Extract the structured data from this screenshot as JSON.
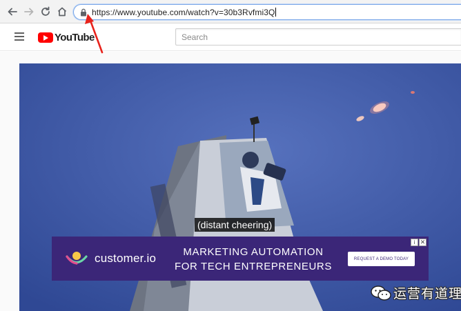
{
  "browser": {
    "url": "https://www.youtube.com/watch?v=30b3Rvfmi3Q",
    "back_icon": "arrow-left-icon",
    "forward_icon": "arrow-right-icon",
    "reload_icon": "reload-icon",
    "home_icon": "home-icon",
    "lock_icon": "lock-icon"
  },
  "youtube": {
    "logo_text": "YouTube",
    "search_placeholder": "Search",
    "menu_icon": "hamburger-menu-icon"
  },
  "video": {
    "caption": "(distant cheering)"
  },
  "ad": {
    "brand": "customer.io",
    "headline_line1": "MARKETING AUTOMATION",
    "headline_line2": "FOR TECH ENTREPRENEURS",
    "cta": "REQUEST A DEMO TODAY",
    "info_glyph": "i",
    "close_glyph": "✕"
  },
  "watermark": {
    "text": "运营有道理"
  },
  "colors": {
    "annotation_arrow": "#e8231c",
    "ad_background": "#3b2678",
    "youtube_red": "#ff0000",
    "omnibox_focus": "#7aa7e8"
  }
}
